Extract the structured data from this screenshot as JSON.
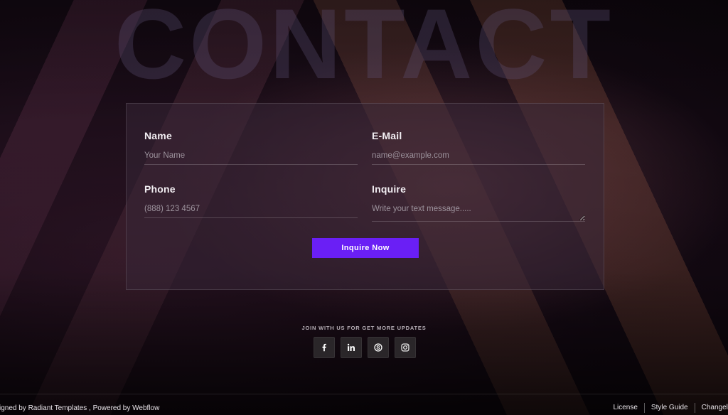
{
  "hero": {
    "title": "CONTACT"
  },
  "form": {
    "name": {
      "label": "Name",
      "placeholder": "Your Name"
    },
    "email": {
      "label": "E-Mail",
      "placeholder": "name@example.com"
    },
    "phone": {
      "label": "Phone",
      "placeholder": "(888) 123 4567"
    },
    "inquire": {
      "label": "Inquire",
      "placeholder": "Write your text message....."
    },
    "submit_label": "Inquire Now"
  },
  "social": {
    "heading": "JOIN WITH US FOR GET MORE UPDATES",
    "icons": [
      "facebook-icon",
      "linkedin-icon",
      "skype-icon",
      "instagram-icon"
    ]
  },
  "footer": {
    "credits": "signed by Radiant Templates , Powered by Webflow",
    "links": [
      "License",
      "Style Guide",
      "Changelog"
    ]
  },
  "colors": {
    "accent": "#6a1ff5"
  }
}
